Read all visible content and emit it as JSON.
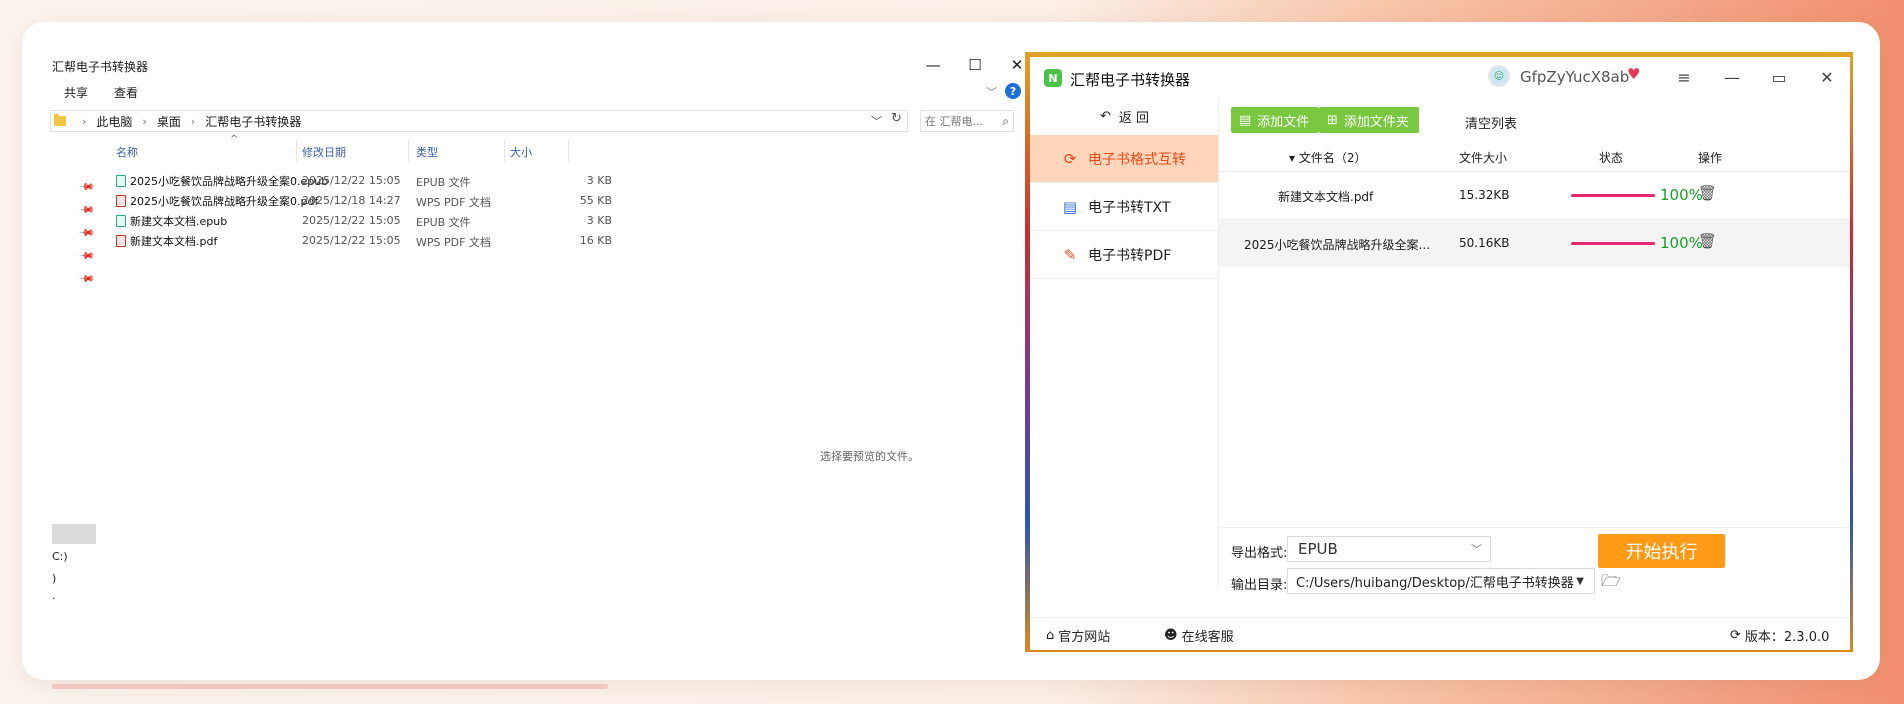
{
  "explorer": {
    "title": "汇帮电子书转换器",
    "window_controls": {
      "minimize": "—",
      "maximize": "☐",
      "close": "✕"
    },
    "menu": [
      "共享",
      "查看"
    ],
    "collapse_glyph": "﹀",
    "help_glyph": "?",
    "breadcrumb": [
      "此电脑",
      "桌面",
      "汇帮电子书转换器"
    ],
    "crumb_sep": "›",
    "addr_chevron": "﹀",
    "refresh_glyph": "↻",
    "search_placeholder": "在 汇帮电...",
    "search_icon_glyph": "⌕",
    "sort_glyph": "^",
    "pin_glyph": "📌",
    "columns": [
      "名称",
      "修改日期",
      "类型",
      "大小"
    ],
    "files": [
      {
        "name": "2025小吃餐饮品牌战略升级全案0.epub",
        "date": "2025/12/22 15:05",
        "type": "EPUB 文件",
        "size": "3 KB",
        "icon": "epub-icon"
      },
      {
        "name": "2025小吃餐饮品牌战略升级全案0.pdf",
        "date": "2025/12/18 14:27",
        "type": "WPS PDF 文档",
        "size": "55 KB",
        "icon": "pdf-icon"
      },
      {
        "name": "新建文本文档.epub",
        "date": "2025/12/22 15:05",
        "type": "EPUB 文件",
        "size": "3 KB",
        "icon": "epub-icon"
      },
      {
        "name": "新建文本文档.pdf",
        "date": "2025/12/22 15:05",
        "type": "WPS PDF 文档",
        "size": "16 KB",
        "icon": "pdf-icon"
      }
    ],
    "preview_text": "选择要预览的文件。",
    "nav_items": [
      "C:)",
      ")",
      "·"
    ]
  },
  "app": {
    "title": "汇帮电子书转换器",
    "logo_glyph": "N",
    "avatar_glyph": "☺",
    "username": "GfpZyYucX8ab",
    "vip_glyph": "♥",
    "window_controls": {
      "menu": "≡",
      "minimize": "—",
      "maximize": "▭",
      "close": "✕"
    },
    "back_glyph": "↶",
    "back_label": "返  回",
    "sidebar": [
      {
        "label": "电子书格式互转",
        "icon": "convert-icon",
        "glyph": "⟳",
        "active": true
      },
      {
        "label": "电子书转TXT",
        "icon": "txt-icon",
        "glyph": "▤",
        "active": false
      },
      {
        "label": "电子书转PDF",
        "icon": "pdf-icon",
        "glyph": "✎",
        "active": false
      }
    ],
    "buttons": {
      "add_file": "添加文件",
      "add_file_glyph": "▤",
      "add_folder": "添加文件夹",
      "add_folder_glyph": "⊞",
      "clear_list": "清空列表",
      "start": "开始执行"
    },
    "table_headers": {
      "name": "文件名（2）",
      "name_glyph": "▾",
      "size": "文件大小",
      "status": "状态",
      "action": "操作"
    },
    "rows": [
      {
        "name": "新建文本文档.pdf",
        "size": "15.32KB",
        "progress": 100,
        "percent": "100%"
      },
      {
        "name": "2025小吃餐饮品牌战略升级全案...",
        "size": "50.16KB",
        "progress": 100,
        "percent": "100%"
      }
    ],
    "trash_glyph": "🗑",
    "export_format_label": "导出格式:",
    "export_format_value": "EPUB",
    "export_chevron": "﹀",
    "output_dir_label": "输出目录:",
    "output_dir_value": "C:/Users/huibang/Desktop/汇帮电子书转换器",
    "dir_chevron": "▼",
    "dir_folder_glyph": "🗁",
    "footer": {
      "website": "官方网站",
      "website_glyph": "⌂",
      "support": "在线客服",
      "support_glyph": "☻",
      "version": "版本：2.3.0.0",
      "version_glyph": "⟳"
    },
    "colors": {
      "accent_green": "#79c83f",
      "accent_orange": "#ff9a16",
      "active_bg": "#fcd5bb",
      "progress": "#e6266f"
    }
  }
}
